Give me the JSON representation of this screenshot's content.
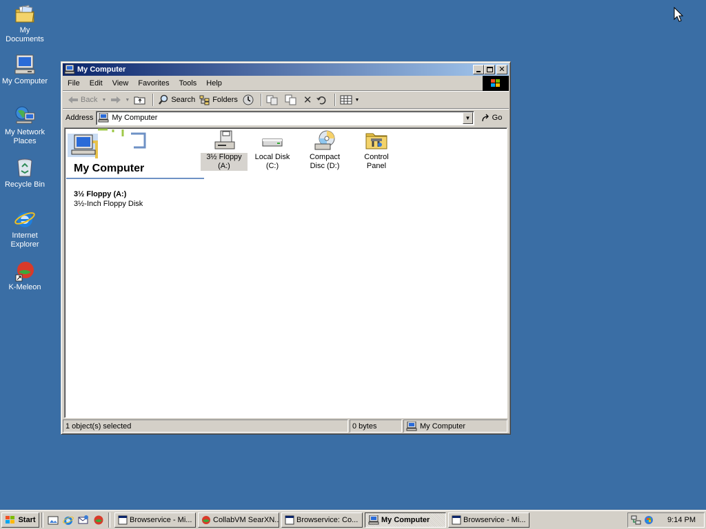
{
  "desktop": {
    "background": "#3a6ea5",
    "icons": [
      {
        "label": "My Documents",
        "icon": "my-documents-icon"
      },
      {
        "label": "My Computer",
        "icon": "my-computer-icon"
      },
      {
        "label": "My Network Places",
        "icon": "network-places-icon"
      },
      {
        "label": "Recycle Bin",
        "icon": "recycle-bin-icon"
      },
      {
        "label": "Internet Explorer",
        "icon": "internet-explorer-icon"
      },
      {
        "label": "K-Meleon",
        "icon": "k-meleon-icon"
      }
    ]
  },
  "window": {
    "title": "My Computer",
    "menu": [
      "File",
      "Edit",
      "View",
      "Favorites",
      "Tools",
      "Help"
    ],
    "toolbar": {
      "back": "Back",
      "search": "Search",
      "folders": "Folders"
    },
    "address": {
      "label": "Address",
      "value": "My Computer",
      "go": "Go"
    },
    "webview": {
      "title": "My Computer",
      "selected_name": "3½ Floppy (A:)",
      "selected_desc": "3½-Inch Floppy Disk"
    },
    "drives": [
      {
        "label": "3½ Floppy (A:)",
        "icon": "floppy-drive-icon",
        "selected": true
      },
      {
        "label": "Local Disk (C:)",
        "icon": "hard-disk-icon",
        "selected": false
      },
      {
        "label": "Compact Disc (D:)",
        "icon": "cd-drive-icon",
        "selected": false
      },
      {
        "label": "Control Panel",
        "icon": "control-panel-icon",
        "selected": false
      }
    ],
    "status": {
      "selection": "1 object(s) selected",
      "size": "0 bytes",
      "location": "My Computer"
    }
  },
  "taskbar": {
    "start": "Start",
    "tasks": [
      {
        "label": "Browservice - Mi...",
        "active": false
      },
      {
        "label": "CollabVM SearXN...",
        "active": false
      },
      {
        "label": "Browservice: Co...",
        "active": false
      },
      {
        "label": "My Computer",
        "active": true
      },
      {
        "label": "Browservice - Mi...",
        "active": false
      }
    ],
    "clock": "9:14 PM"
  }
}
